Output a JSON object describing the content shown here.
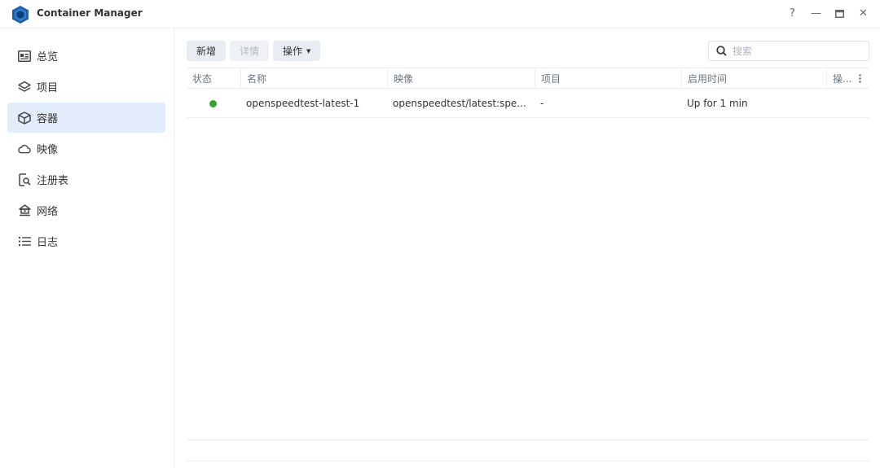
{
  "app": {
    "title": "Container Manager",
    "window_controls": [
      "?",
      "—",
      "□",
      "✕"
    ]
  },
  "sidebar": {
    "items": [
      {
        "label": "总览",
        "icon": "overview-icon",
        "active": false
      },
      {
        "label": "项目",
        "icon": "layers-icon",
        "active": false
      },
      {
        "label": "容器",
        "icon": "cube-icon",
        "active": true
      },
      {
        "label": "映像",
        "icon": "cloud-icon",
        "active": false
      },
      {
        "label": "注册表",
        "icon": "registry-search-icon",
        "active": false
      },
      {
        "label": "网络",
        "icon": "network-home-icon",
        "active": false
      },
      {
        "label": "日志",
        "icon": "list-icon",
        "active": false
      }
    ]
  },
  "toolbar": {
    "new_label": "新增",
    "details_label": "详情",
    "action_label": "操作"
  },
  "search": {
    "placeholder": "搜索",
    "value": ""
  },
  "table": {
    "columns": [
      "状态",
      "名称",
      "映像",
      "项目",
      "启用时间",
      "操..."
    ],
    "rows": [
      {
        "status": "running",
        "name": "openspeedtest-latest-1",
        "image": "openspeedtest/latest:spe...",
        "project": "-",
        "uptime": "Up for 1 min"
      }
    ]
  },
  "colors": {
    "accent_active": "#e2ecfa",
    "status_running": "#2fa52f",
    "logo_blue": "#1f5fa8"
  }
}
